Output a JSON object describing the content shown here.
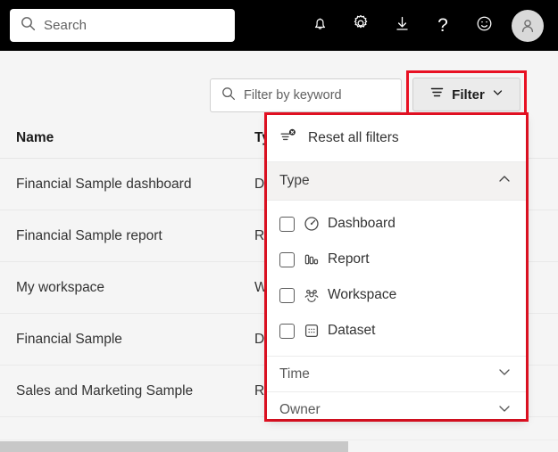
{
  "topbar": {
    "search": {
      "placeholder": "Search",
      "icon": "search-icon"
    },
    "icons": [
      {
        "name": "notifications-bell-icon",
        "label": ""
      },
      {
        "name": "settings-gear-icon",
        "label": ""
      },
      {
        "name": "downloads-icon",
        "label": ""
      },
      {
        "name": "help-question-icon",
        "label": "?"
      },
      {
        "name": "feedback-smiley-icon",
        "label": ""
      }
    ],
    "avatar": {
      "name": "account-avatar",
      "label": ""
    }
  },
  "toolbar": {
    "keyword_filter": {
      "placeholder": "Filter by keyword",
      "value": "",
      "icon": "search-icon"
    },
    "filter_button": {
      "label": "Filter",
      "icon": "filter-lines-icon",
      "chevron": "chevron-down-icon"
    }
  },
  "table": {
    "columns": [
      "Name",
      "Type"
    ],
    "rows": [
      {
        "name": "Financial Sample dashboard",
        "type": "Da"
      },
      {
        "name": "Financial Sample report",
        "type": "Rep"
      },
      {
        "name": "My workspace",
        "type": "Wo"
      },
      {
        "name": "Financial Sample",
        "type": "Da"
      },
      {
        "name": "Sales and Marketing Sample",
        "type": "Rep"
      }
    ]
  },
  "filter_panel": {
    "reset": {
      "label": "Reset all filters",
      "icon": "reset-filters-icon"
    },
    "sections": [
      {
        "title": "Type",
        "expanded": true,
        "chevron": "chevron-up-icon"
      },
      {
        "title": "Time",
        "expanded": false,
        "chevron": "chevron-down-icon"
      },
      {
        "title": "Owner",
        "expanded": false,
        "chevron": "chevron-down-icon"
      }
    ],
    "type_options": [
      {
        "label": "Dashboard",
        "checked": false,
        "icon": "dashboard-gauge-icon"
      },
      {
        "label": "Report",
        "checked": false,
        "icon": "report-bars-icon"
      },
      {
        "label": "Workspace",
        "checked": false,
        "icon": "workspace-people-icon"
      },
      {
        "label": "Dataset",
        "checked": false,
        "icon": "dataset-grid-icon"
      }
    ]
  },
  "colors": {
    "highlight": "#e81123",
    "header_bg": "#000000",
    "page_bg": "#f5f5f5",
    "section_bg": "#f3f2f1"
  }
}
